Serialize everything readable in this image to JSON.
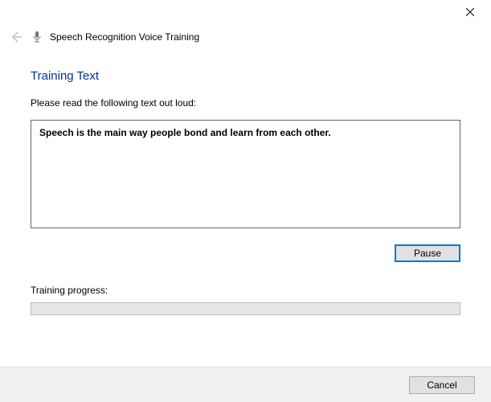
{
  "header": {
    "title": "Speech Recognition Voice Training"
  },
  "section": {
    "title": "Training Text",
    "instructions": "Please read the following text out loud:",
    "reading_text": "Speech is the main way people bond and learn from each other.",
    "progress_label": "Training progress:"
  },
  "buttons": {
    "pause": "Pause",
    "cancel": "Cancel"
  }
}
